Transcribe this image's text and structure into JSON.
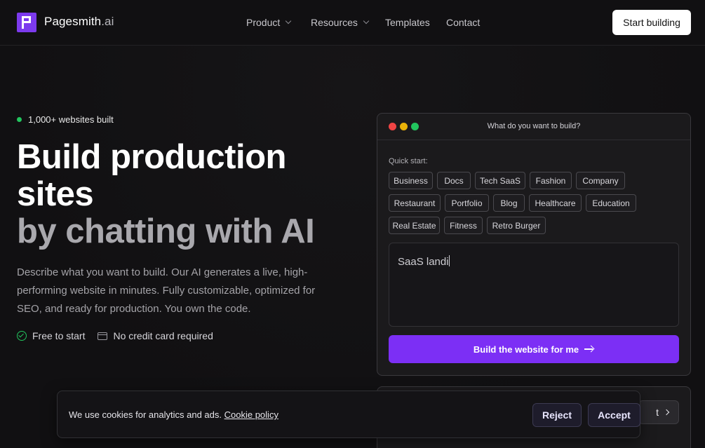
{
  "nav": {
    "brand": "Pagesmith",
    "brand_suffix": ".ai",
    "links": [
      {
        "label": "Product",
        "dropdown": true
      },
      {
        "label": "Resources",
        "dropdown": true
      },
      {
        "label": "Templates",
        "dropdown": false
      },
      {
        "label": "Contact",
        "dropdown": false
      }
    ],
    "cta": "Start building"
  },
  "hero": {
    "badge": "1,000+ websites built",
    "title_line1": "Build production",
    "title_line2": "sites",
    "title_line3": "by chatting with AI",
    "description": "Describe what you want to build. Our AI generates a live, high-performing website in minutes. Fully customizable, optimized for SEO, and ready for production. You own the code.",
    "perks": [
      "Free to start",
      "No credit card required"
    ]
  },
  "builder": {
    "window_title": "What do you want to build?",
    "quick_start_label": "Quick start:",
    "chips": [
      "Business",
      "Docs",
      "Tech SaaS",
      "Fashion",
      "Company",
      "Restaurant",
      "Portfolio",
      "Blog",
      "Healthcare",
      "Education",
      "Real Estate",
      "Fitness",
      "Retro Burger"
    ],
    "prompt_value": "SaaS landi",
    "build_button": "Build the website for me"
  },
  "secondary_card": {
    "button_partial": "t"
  },
  "cookie_banner": {
    "text": "We use cookies for analytics and ads.",
    "link": "Cookie policy",
    "reject": "Reject",
    "accept": "Accept"
  },
  "colors": {
    "accent": "#7c2ff5",
    "brand": "#7c3aed",
    "success": "#22c55e"
  }
}
